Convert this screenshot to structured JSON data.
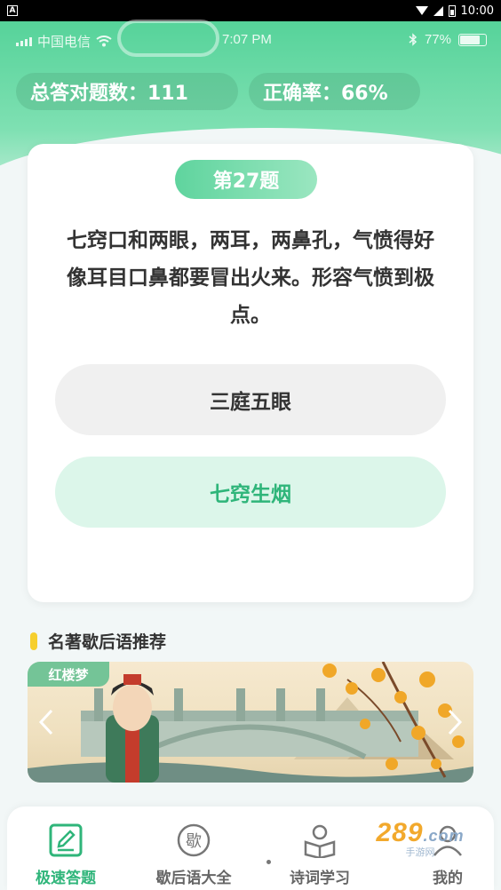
{
  "system_status_bar": {
    "notification_badge": "A",
    "time": "10:00"
  },
  "ios_status_bar": {
    "carrier": "中国电信",
    "time": "7:07 PM",
    "battery": "77%",
    "battery_level": 0.77
  },
  "stats": {
    "total_correct": "总答对题数：111",
    "accuracy": "正确率：66%"
  },
  "question": {
    "number_label": "第27题",
    "text": "七窍口和两眼，两耳，两鼻孔，气愤得好像耳目口鼻都要冒出火来。形容气愤到极点。",
    "options": [
      {
        "label": "三庭五眼",
        "state": "default"
      },
      {
        "label": "七窍生烟",
        "state": "highlighted"
      }
    ]
  },
  "recommend_section": {
    "title": "名著歇后语推荐",
    "banner_tag": "红楼梦"
  },
  "bottom_nav": {
    "items": [
      {
        "label": "极速答题",
        "icon": "edit-icon",
        "active": true
      },
      {
        "label": "歇后语大全",
        "icon": "xie-seal-icon",
        "icon_glyph": "歇",
        "active": false
      },
      {
        "label": "诗词学习",
        "icon": "reading-icon",
        "active": false
      },
      {
        "label": "我的",
        "icon": "profile-icon",
        "active": false
      }
    ]
  },
  "watermark": {
    "logo": "289",
    "sub": "手游网",
    "suffix": ".com"
  },
  "colors": {
    "brand_green": "#56d39a",
    "accent_text_green": "#2fb57a",
    "highlight_option_bg": "#dcf6ea",
    "section_marker": "#f6cf2e"
  }
}
